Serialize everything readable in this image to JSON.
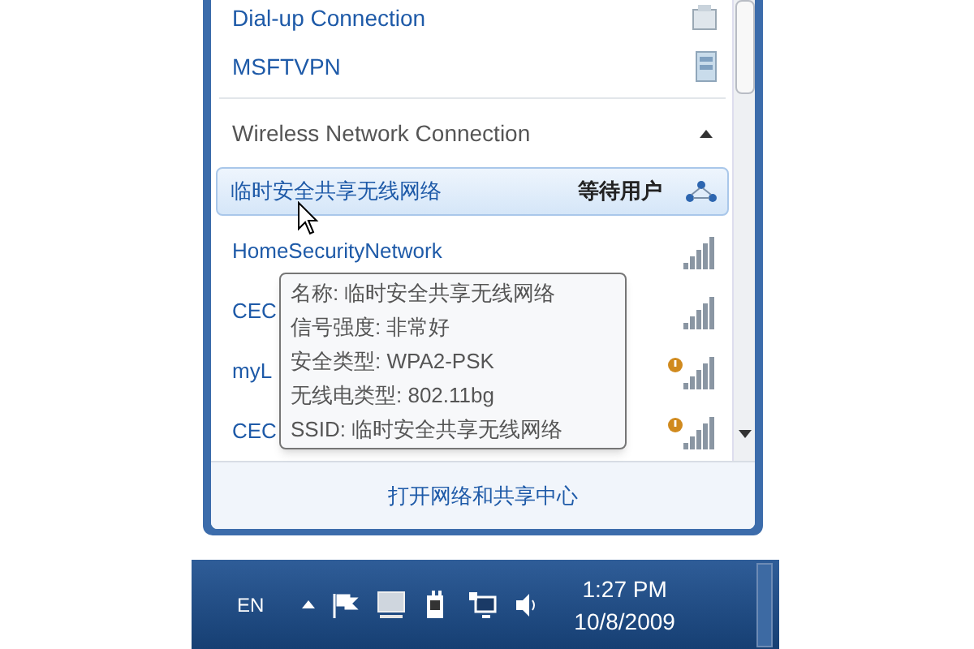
{
  "connections": [
    {
      "name": "Dial-up Connection",
      "kind": "dialup"
    },
    {
      "name": "MSFTVPN",
      "kind": "vpn"
    }
  ],
  "wireless": {
    "title": "Wireless Network Connection",
    "expanded": true,
    "networks": [
      {
        "name": "临时安全共享无线网络",
        "status": "等待用户",
        "kind": "adhoc",
        "selected": true
      },
      {
        "name": "HomeSecurityNetwork",
        "kind": "wifi",
        "selected": false,
        "warning": false
      },
      {
        "name": "CEC",
        "kind": "wifi",
        "selected": false,
        "warning": false
      },
      {
        "name": "myL",
        "kind": "wifi",
        "selected": false,
        "warning": true
      },
      {
        "name": "CEC",
        "kind": "wifi",
        "selected": false,
        "warning": true
      }
    ]
  },
  "tooltip": [
    "名称: 临时安全共享无线网络",
    "信号强度: 非常好",
    "安全类型: WPA2-PSK",
    "无线电类型: 802.11bg",
    "SSID: 临时安全共享无线网络"
  ],
  "footer_link": "打开网络和共享中心",
  "taskbar": {
    "language": "EN",
    "time": "1:27 PM",
    "date": "10/8/2009"
  }
}
